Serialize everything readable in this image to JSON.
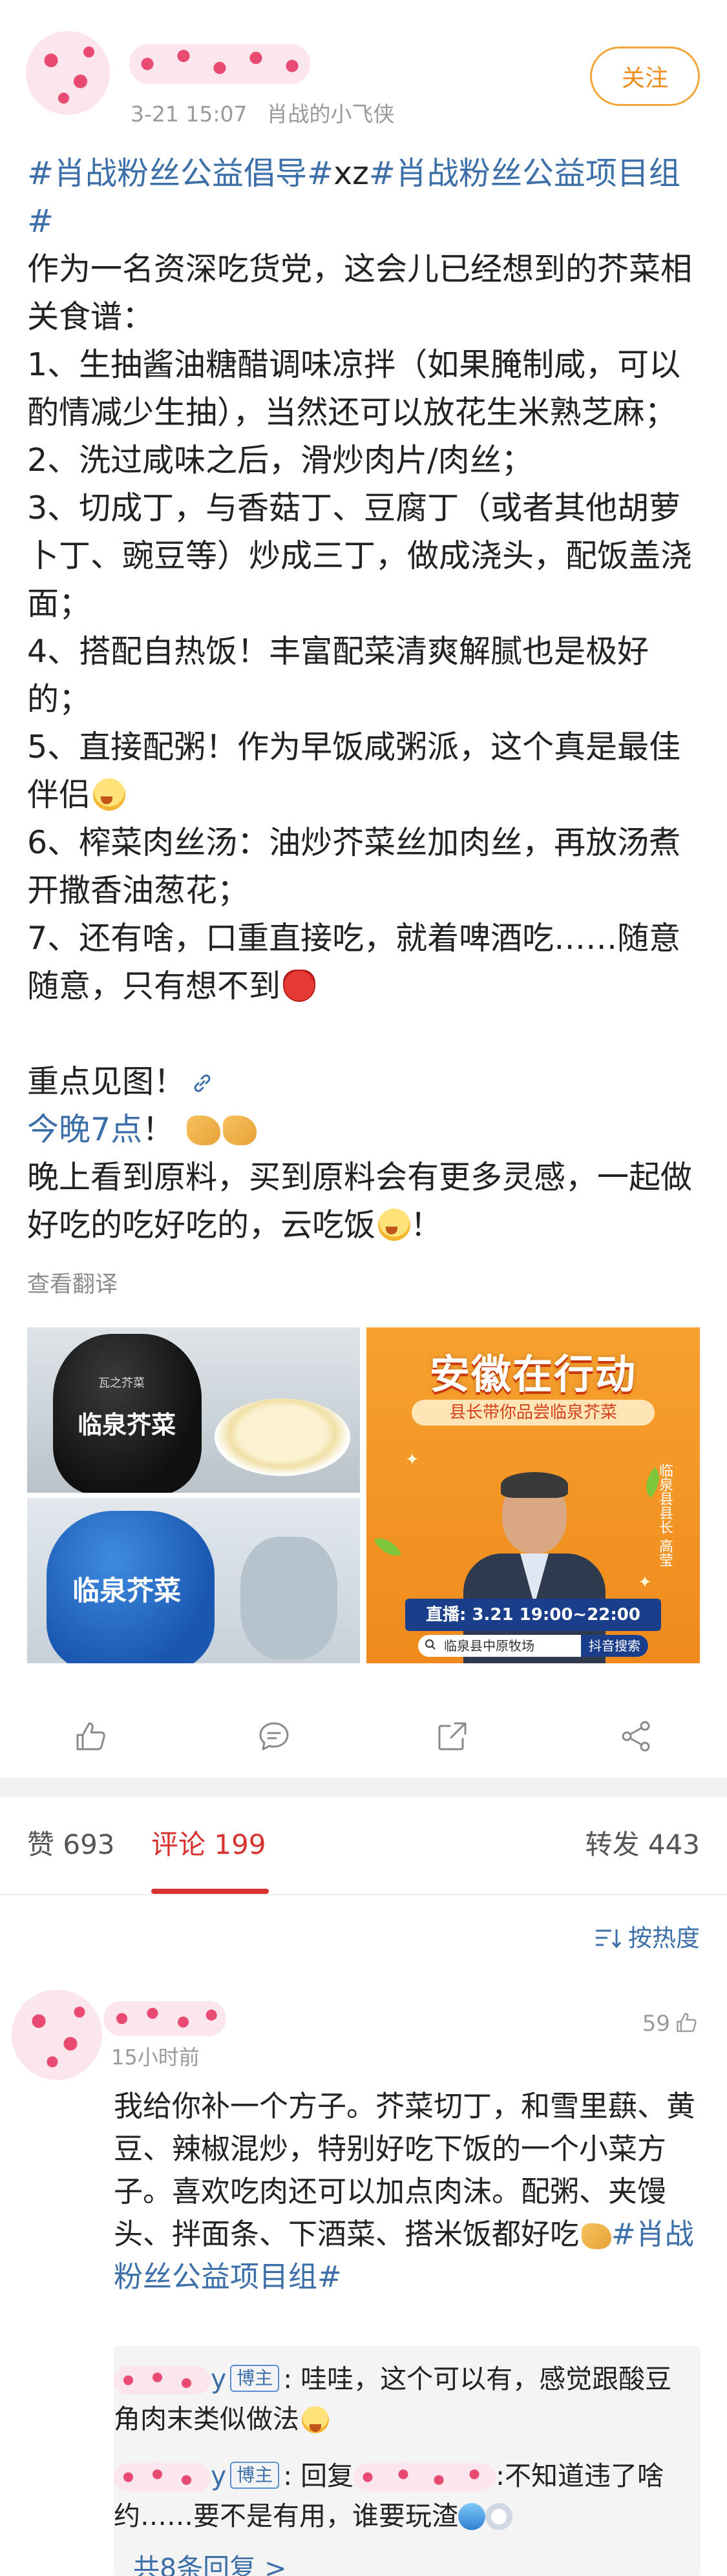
{
  "post": {
    "time": "3-21 15:07",
    "source": "肖战的小飞侠",
    "follow_label": "关注",
    "tag1": "#肖战粉丝公益倡导#",
    "tag_mid": "xz",
    "tag2": "#肖战粉丝公益项目组#",
    "intro": "作为一名资深吃货党，这会儿已经想到的芥菜相关食谱：",
    "item1": "1、生抽酱油糖醋调味凉拌（如果腌制咸，可以酌情减少生抽），当然还可以放花生米熟芝麻；",
    "item2": "2、洗过咸味之后，滑炒肉片/肉丝；",
    "item3": "3、切成丁，与香菇丁、豆腐丁（或者其他胡萝卜丁、豌豆等）炒成三丁，做成浇头，配饭盖浇面；",
    "item4": "4、搭配自热饭！丰富配菜清爽解腻也是极好的；",
    "item5": "5、直接配粥！作为早饭咸粥派，这个真是最佳伴侣",
    "item6": "6、榨菜肉丝汤：油炒芥菜丝加肉丝，再放汤煮开撒香油葱花；",
    "item7": "7、还有啥，口重直接吃，就着啤酒吃……随意随意，只有想不到",
    "keypoint": "重点见图！",
    "tonight_link": "今晚7点",
    "tonight_punct": "！",
    "closing_a": "晚上看到原料，买到原料会有更多灵感，一起做好吃的吃好吃的，云吃饭",
    "closing_b": "！",
    "translate": "查看翻译"
  },
  "images": {
    "jar_label": "临泉芥菜",
    "jar_small": "瓦之芥菜",
    "promo_title": "安徽在行动",
    "promo_subtitle": "县长带你品尝临泉芥菜",
    "promo_live": "直播: 3.21  19:00~22:00",
    "promo_search": "临泉县中原牧场",
    "promo_search_btn": "抖音搜索",
    "promo_side": "临泉县县长 高莹"
  },
  "tabs": {
    "likes": "赞 693",
    "comments": "评论 199",
    "reposts": "转发 443"
  },
  "sort_label": "按热度",
  "comment": {
    "time": "15小时前",
    "likes": "59",
    "text": "我给你补一个方子。芥菜切丁，和雪里蕻、黄豆、辣椒混炒，特别好吃下饭的一个小菜方子。喜欢吃肉还可以加点肉沫。配粥、夹馒头、拌面条、下酒菜、搭米饭都好吃",
    "tag": "#肖战粉丝公益项目组#"
  },
  "replies": {
    "r1_tail": "y",
    "host_badge": "博主",
    "r1_text": ": 哇哇，这个可以有，感觉跟酸豆角肉末类似做法",
    "r2_tail": "y",
    "r2_prefix": ": 回复",
    "r2_text": ":不知道违了啥约……要不是有用，谁要玩渣",
    "more": "共8条回复 >"
  },
  "colors": {
    "link": "#3d6fa8",
    "accent_red": "#d8322f",
    "follow_orange": "#f08c1a",
    "meta_gray": "#9a9a9a"
  }
}
